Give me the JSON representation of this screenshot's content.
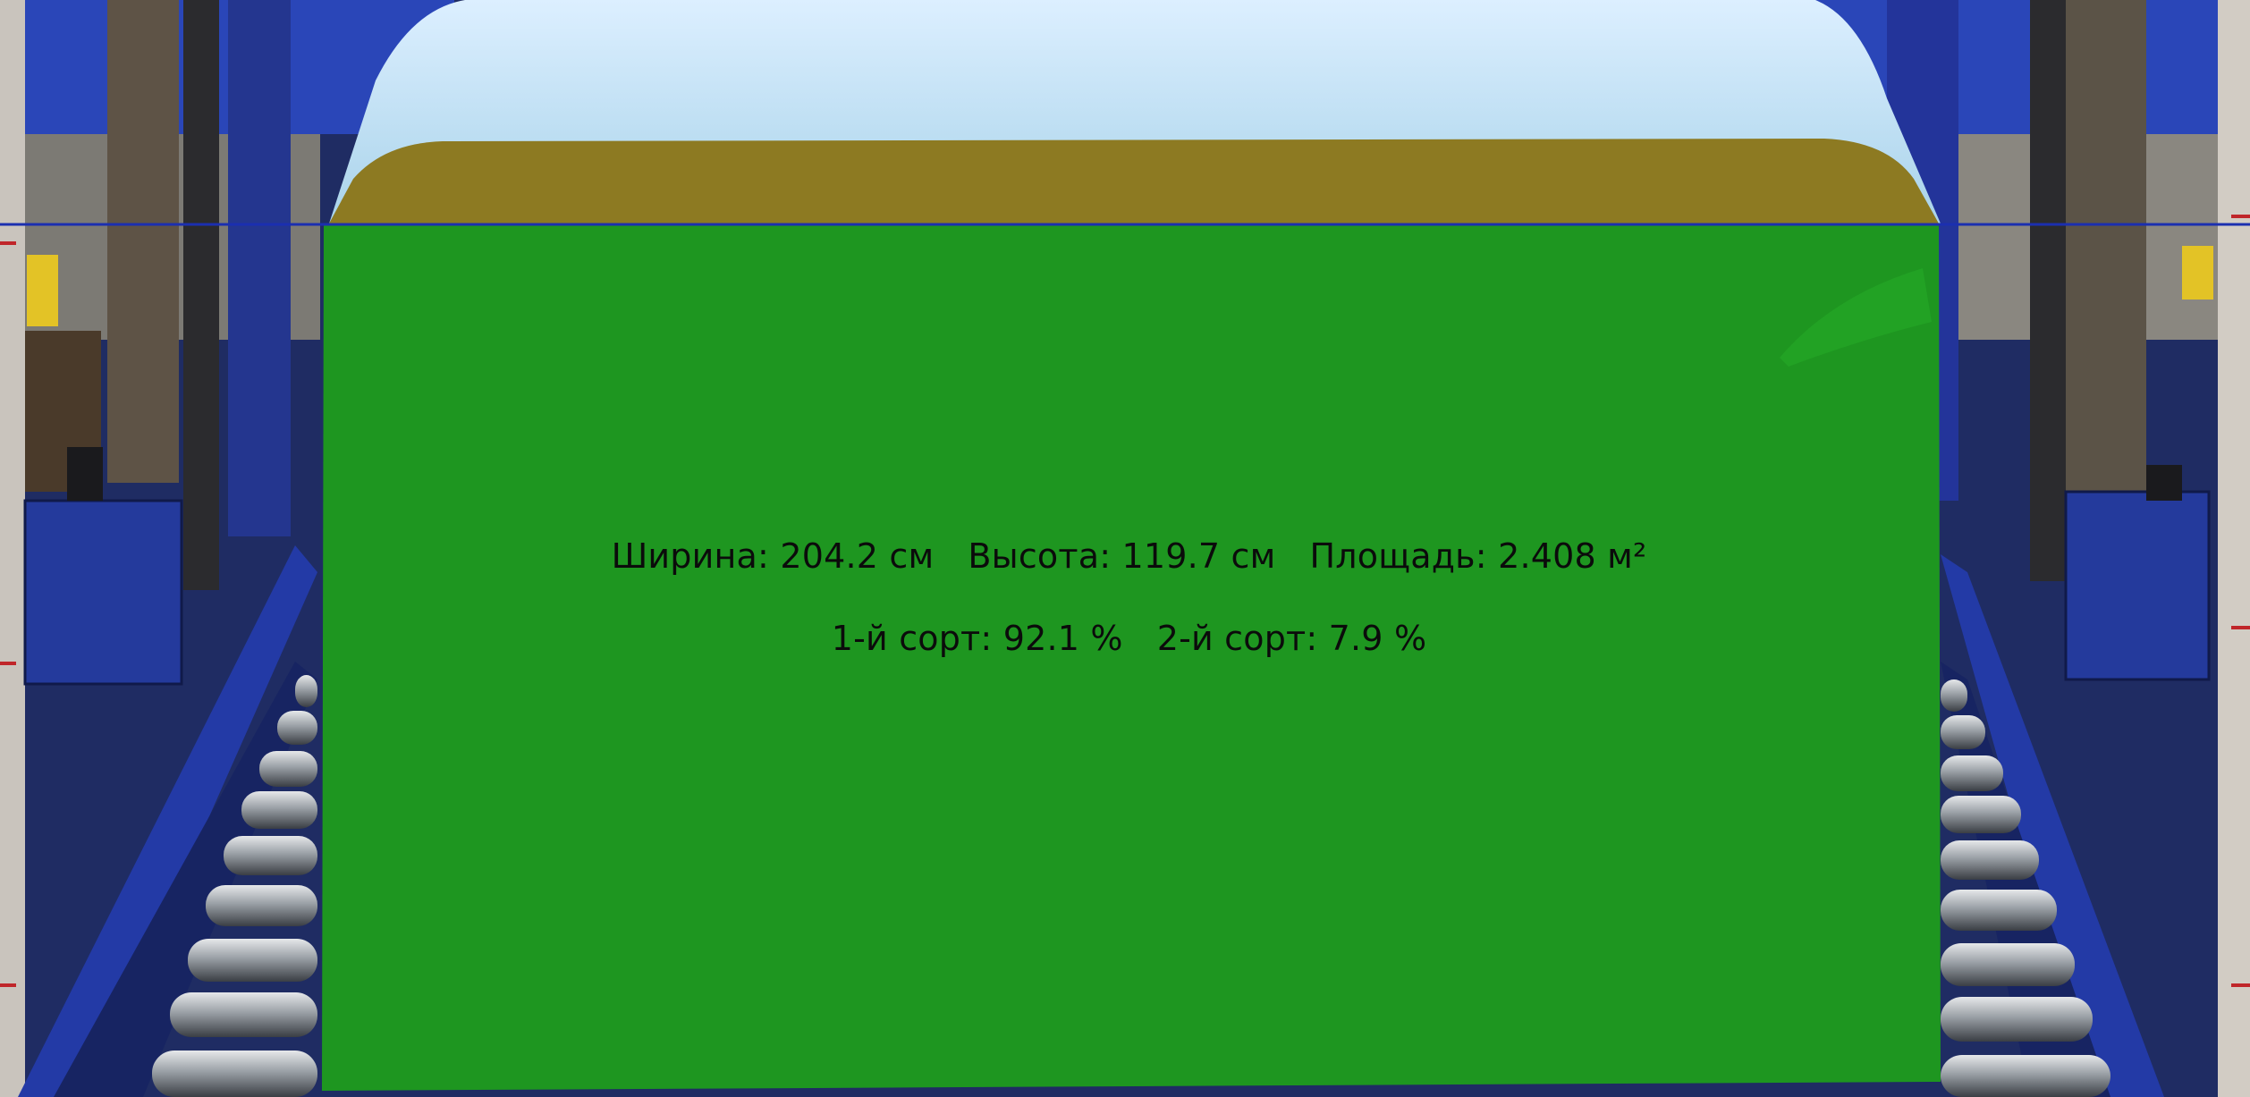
{
  "measurement": {
    "width_label": "Ширина:",
    "width_value": "204.2 см",
    "height_label": "Высота:",
    "height_value": "119.7 см",
    "area_label": "Площадь:",
    "area_value": "2.408 м²",
    "grade1_label": "1-й сорт:",
    "grade1_value": "92.1 %",
    "grade2_label": "2-й сорт:",
    "grade2_value": "7.9 %"
  },
  "colors": {
    "first_grade_overlay": "#1e9620",
    "second_grade_overlay": "#8d7a22",
    "reference_line": "#1b2fb0",
    "foam_block": "#bfe0f0",
    "conveyor_frame": "#23349a",
    "text": "#0b0b0b"
  }
}
